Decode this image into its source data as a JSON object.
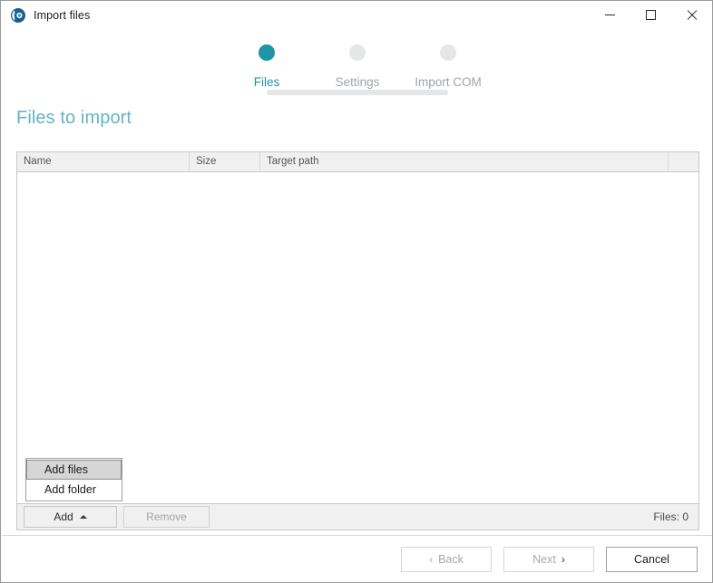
{
  "window": {
    "title": "Import files",
    "app_icon": "app-logo-icon",
    "controls": {
      "minimize": "minimize-icon",
      "maximize": "maximize-icon",
      "close": "close-icon"
    }
  },
  "colors": {
    "accent": "#1f95a5",
    "heading": "#62b4c6",
    "step_inactive": "#e4e6e8",
    "step_label_inactive": "#9fa4a8",
    "panel_bg": "#f0f0f0",
    "border": "#c8c8c8"
  },
  "stepper": {
    "steps": [
      {
        "label": "Files",
        "state": "active"
      },
      {
        "label": "Settings",
        "state": "inactive"
      },
      {
        "label": "Import COM",
        "state": "inactive"
      }
    ]
  },
  "main": {
    "page_title": "Files to import",
    "table": {
      "columns": [
        {
          "label": "Name"
        },
        {
          "label": "Size"
        },
        {
          "label": "Target path"
        },
        {
          "label": ""
        }
      ],
      "rows": []
    },
    "toolbar": {
      "add_label": "Add",
      "add_caret": "caret-up-icon",
      "remove_label": "Remove",
      "files_count": "Files: 0"
    },
    "dropdown": {
      "open": true,
      "items": [
        {
          "label": "Add files",
          "highlighted": true
        },
        {
          "label": "Add folder",
          "highlighted": false
        }
      ]
    }
  },
  "footer": {
    "back_chevron": "‹",
    "back_label": "Back",
    "next_label": "Next",
    "next_chevron": "›",
    "cancel_label": "Cancel"
  }
}
